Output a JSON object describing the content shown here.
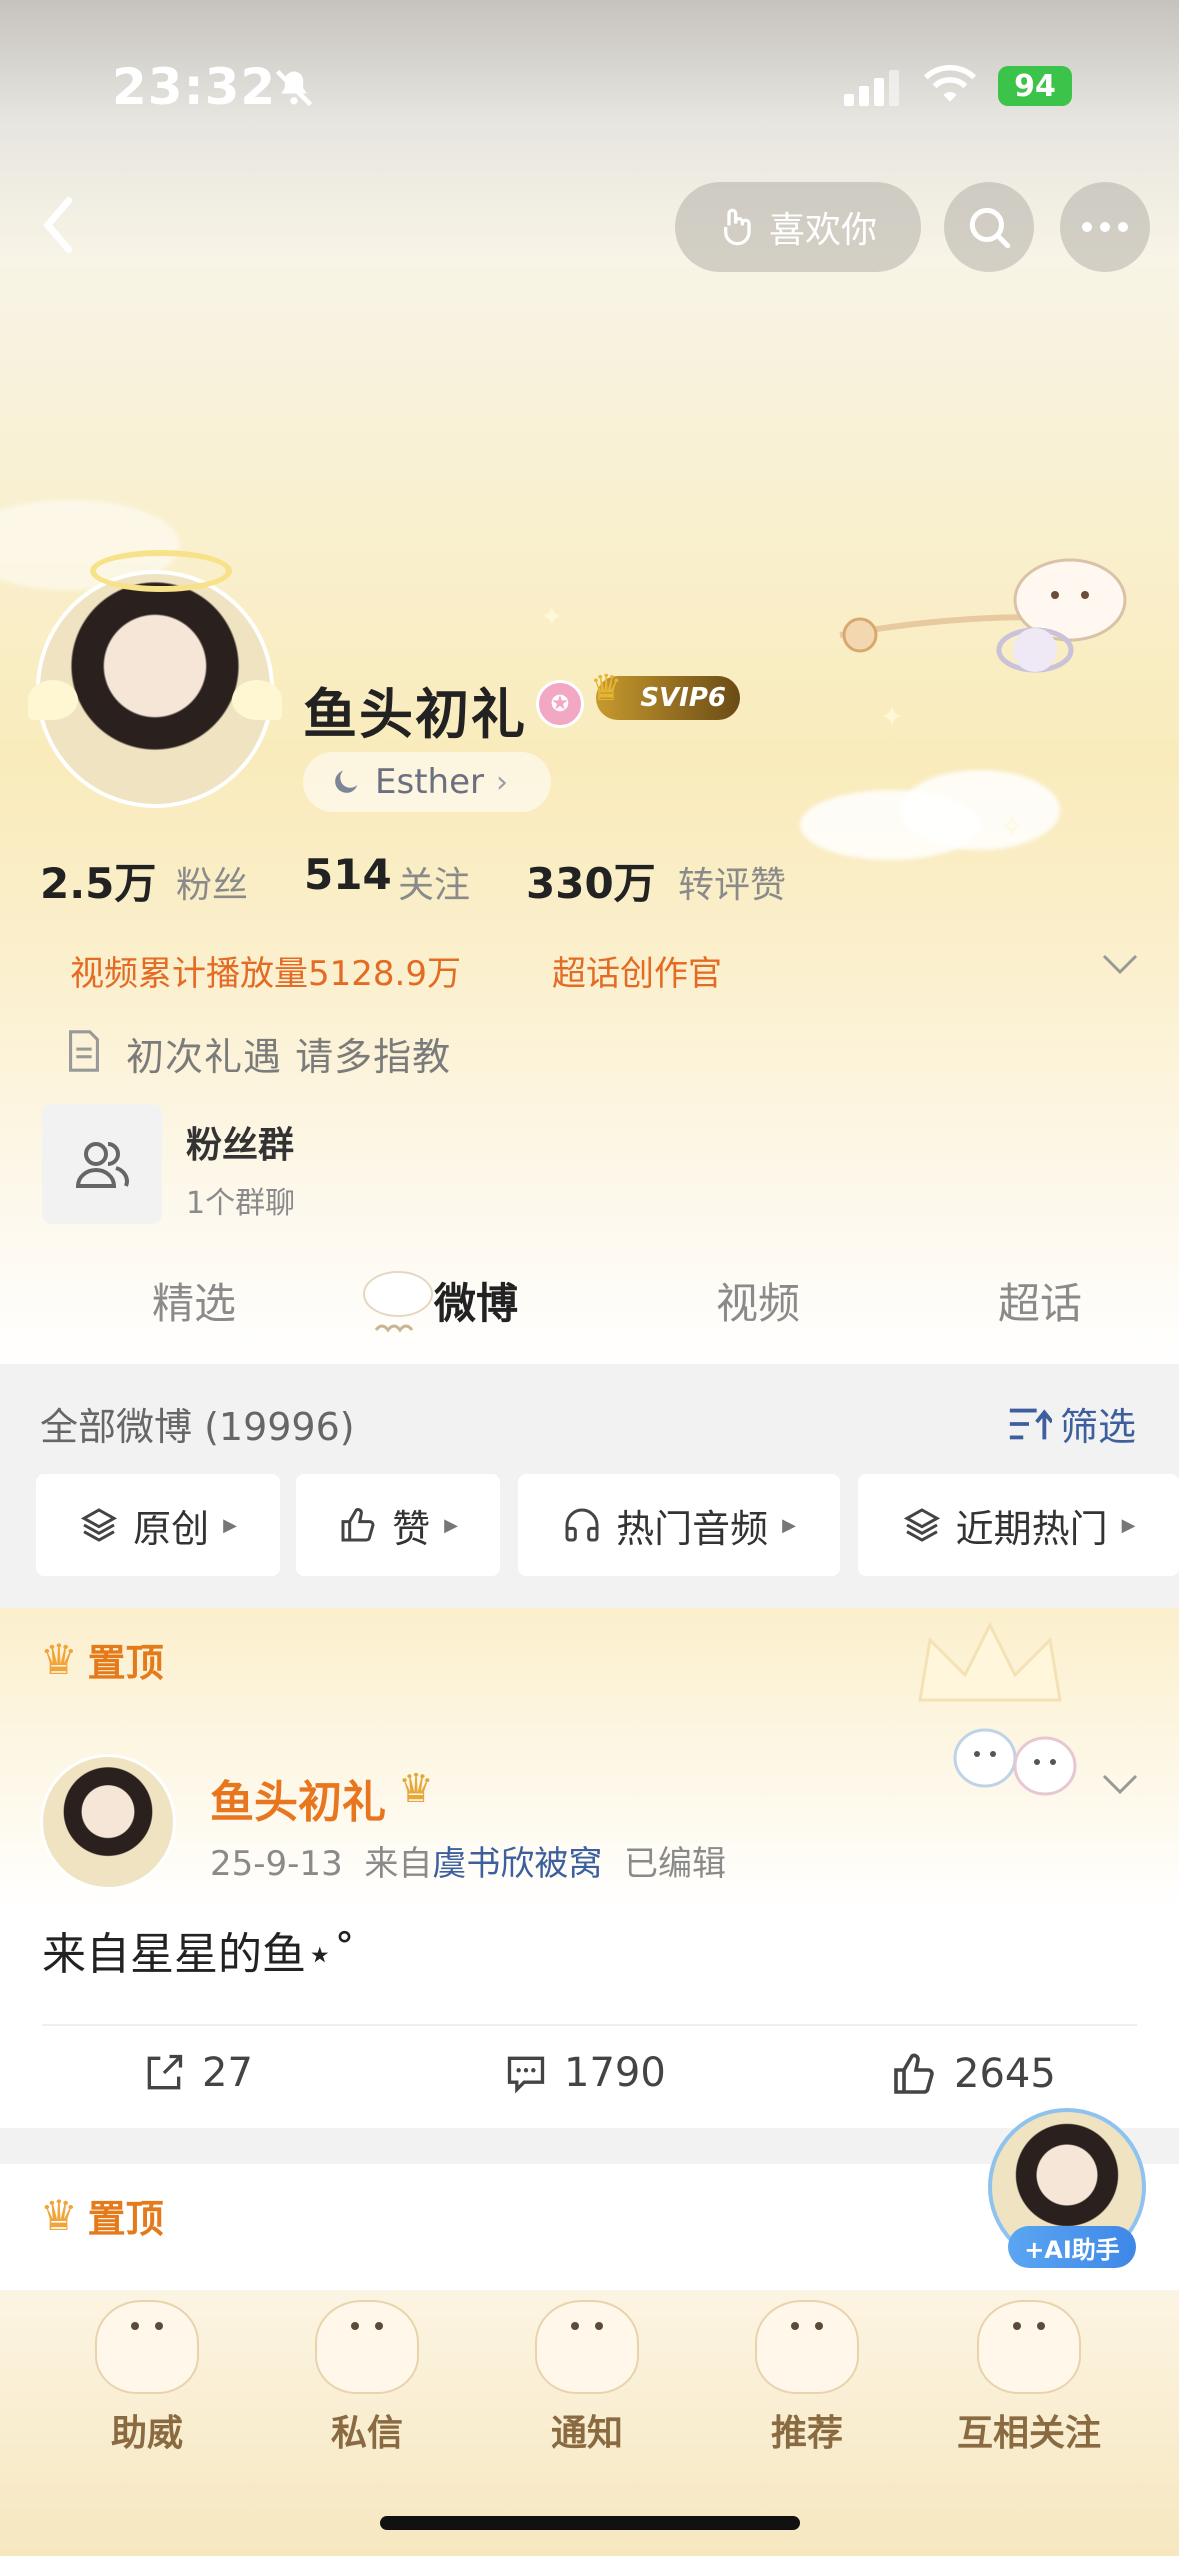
{
  "status_bar": {
    "time": "23:32",
    "battery": "94"
  },
  "header": {
    "like_you_label": "喜欢你"
  },
  "profile": {
    "name": "鱼头初礼",
    "svip_label": "SVIP6",
    "tag_label": "Esther",
    "stats": [
      {
        "num": "2.5万",
        "label": "粉丝"
      },
      {
        "num": "514",
        "label": "关注"
      },
      {
        "num": "330万",
        "label": "转评赞"
      }
    ],
    "video_plays": "视频累计播放量5128.9万",
    "super_creator": "超话创作官",
    "bio": "初次礼遇 请多指教",
    "fan_group": {
      "title": "粉丝群",
      "subtitle": "1个群聊"
    }
  },
  "tabs": [
    {
      "label": "精选"
    },
    {
      "label": "微博"
    },
    {
      "label": "视频"
    },
    {
      "label": "超话"
    }
  ],
  "feed": {
    "all_label": "全部微博 (19996)",
    "filter_label": "筛选",
    "chips": [
      {
        "label": "原创",
        "icon": "layers-icon"
      },
      {
        "label": "赞",
        "icon": "thumbs-up-icon"
      },
      {
        "label": "热门音频",
        "icon": "headphones-icon"
      },
      {
        "label": "近期热门",
        "icon": "layers-icon"
      }
    ],
    "pinned_label": "置顶",
    "post": {
      "author": "鱼头初礼",
      "date": "25-9-13",
      "from_prefix": "来自",
      "source": "虞书欣被窝",
      "edited": "已编辑",
      "text": "来自星星的鱼⋆˚",
      "reposts": "27",
      "comments": "1790",
      "likes": "2645"
    },
    "pinned_label_2": "置顶"
  },
  "ai_assistant": {
    "label": "+AI助手"
  },
  "bottom_nav": [
    {
      "label": "助威"
    },
    {
      "label": "私信"
    },
    {
      "label": "通知"
    },
    {
      "label": "推荐"
    },
    {
      "label": "互相关注"
    }
  ],
  "colors": {
    "accent_orange": "#e36b23",
    "link_blue": "#3e5f9e",
    "battery_green": "#3cc44a"
  }
}
